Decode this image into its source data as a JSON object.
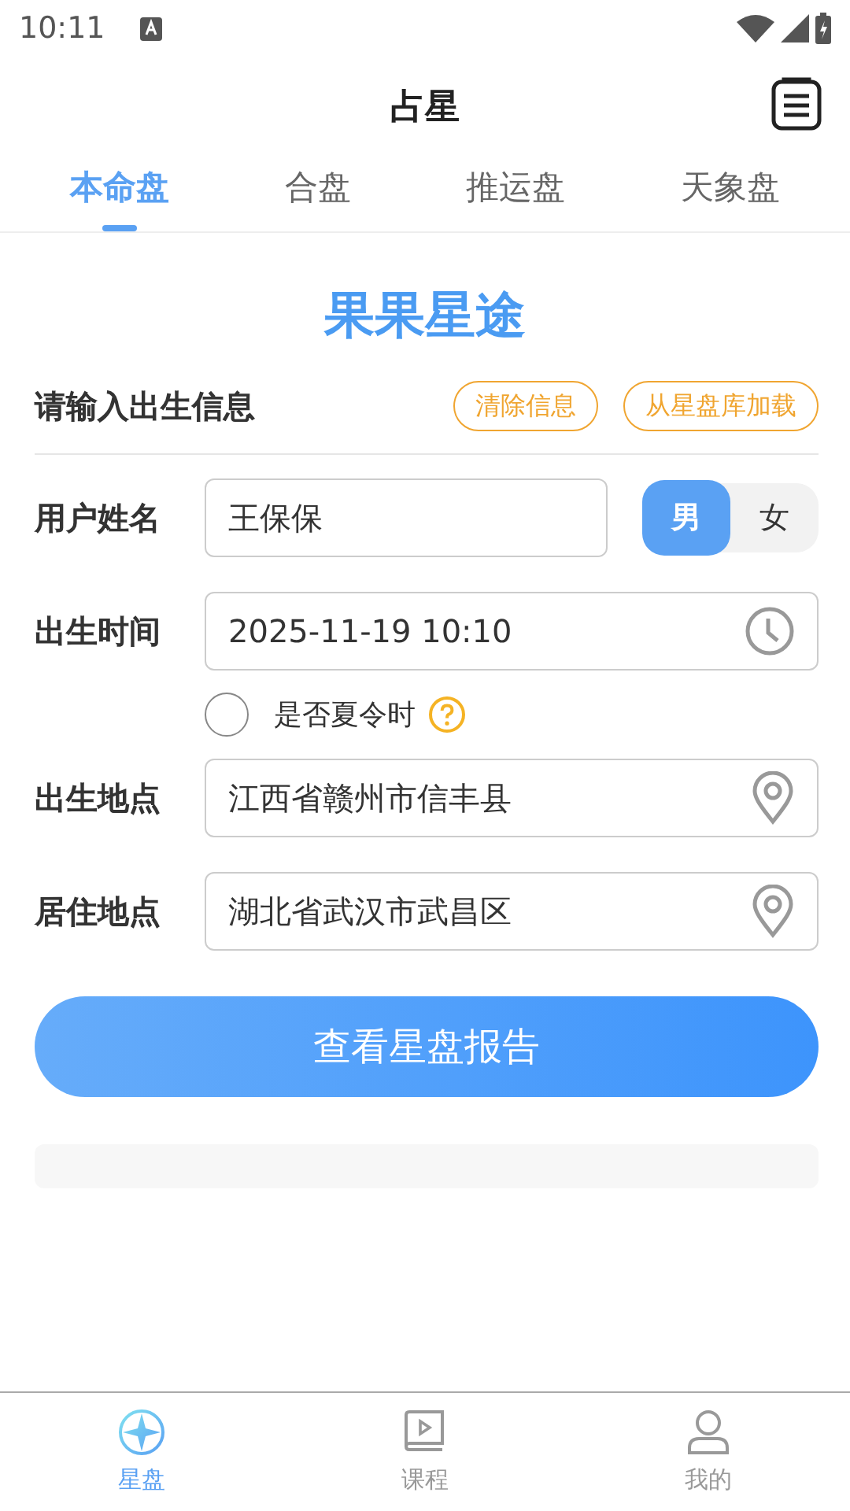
{
  "status_bar": {
    "time": "10:11"
  },
  "header": {
    "title": "占星"
  },
  "tabs": [
    {
      "label": "本命盘",
      "selected": true
    },
    {
      "label": "合盘",
      "selected": false
    },
    {
      "label": "推运盘",
      "selected": false
    },
    {
      "label": "天象盘",
      "selected": false
    }
  ],
  "brand": "果果星途",
  "section": {
    "title": "请输入出生信息",
    "buttons": [
      "清除信息",
      "从星盘库加载"
    ]
  },
  "name_row": {
    "label": "用户姓名",
    "value": "王保保",
    "genders": [
      {
        "label": "男",
        "selected": true
      },
      {
        "label": "女",
        "selected": false
      }
    ]
  },
  "time_row": {
    "label": "出生时间",
    "value": "2025-11-19 10:10"
  },
  "dst": {
    "label": "是否夏令时",
    "checked": false
  },
  "birth_place": {
    "label": "出生地点",
    "value": "江西省赣州市信丰县"
  },
  "living_place": {
    "label": "居住地点",
    "value": "湖北省武汉市武昌区"
  },
  "submit": "查看星盘报告",
  "bottom_nav": [
    {
      "kind": "chart",
      "label": "星盘",
      "selected": true
    },
    {
      "kind": "course",
      "label": "课程",
      "selected": false
    },
    {
      "kind": "profile",
      "label": "我的",
      "selected": false
    }
  ]
}
